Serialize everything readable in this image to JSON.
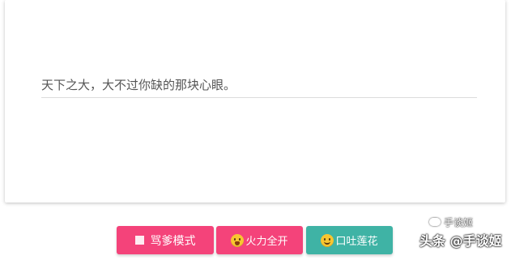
{
  "card": {
    "quote": "天下之大，大不过你缺的那块心眼。"
  },
  "buttons": [
    {
      "label": "骂爹模式",
      "icon": "square-icon",
      "color": "#f4437a"
    },
    {
      "label": "火力全开",
      "icon": "fearful-face-icon",
      "color": "#f4437a"
    },
    {
      "label": "口吐莲花",
      "icon": "smile-face-icon",
      "color": "#3fb3a5"
    }
  ],
  "watermark": {
    "logo_text": "手谈姬",
    "text": "头条 @手谈姬"
  }
}
